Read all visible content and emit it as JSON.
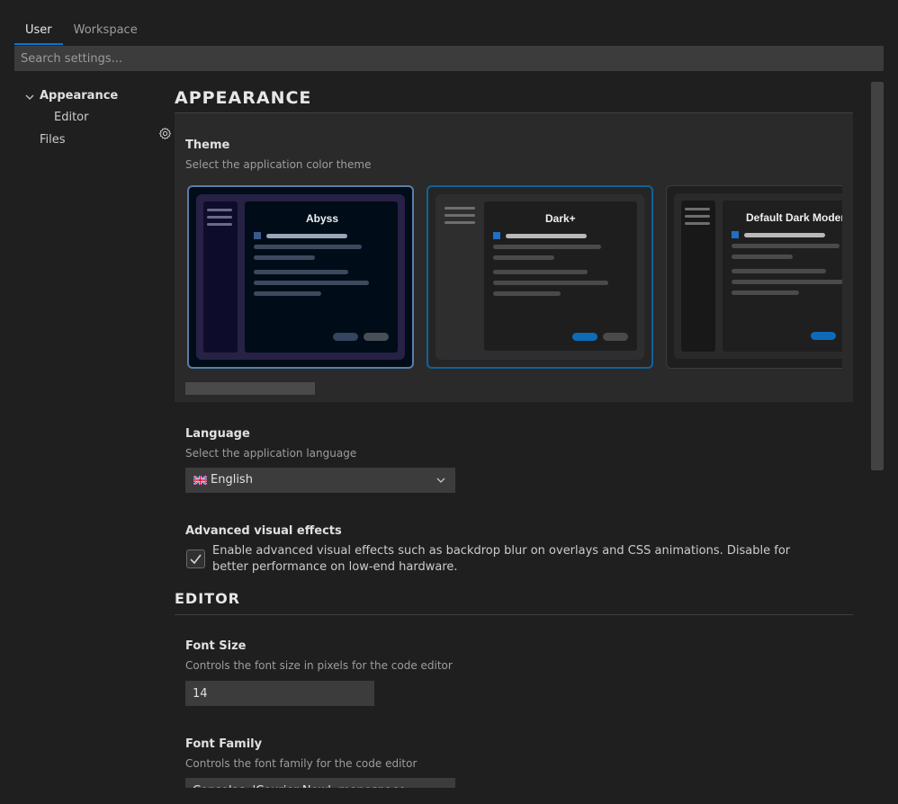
{
  "tabs": [
    {
      "label": "User",
      "active": true
    },
    {
      "label": "Workspace",
      "active": false
    }
  ],
  "search": {
    "placeholder": "Search settings..."
  },
  "tree": {
    "appearance": "Appearance",
    "editor": "Editor",
    "files": "Files"
  },
  "appearance": {
    "heading": "APPEARANCE",
    "theme": {
      "label": "Theme",
      "description": "Select the application color theme",
      "options": [
        {
          "name": "Abyss",
          "selected": false
        },
        {
          "name": "Dark+",
          "selected": true
        },
        {
          "name": "Default Dark Modern",
          "selected": false
        }
      ]
    },
    "language": {
      "label": "Language",
      "description": "Select the application language",
      "value": "English",
      "flag_icon": "uk-flag-icon"
    },
    "visual_effects": {
      "label": "Advanced visual effects",
      "checked": true,
      "description": "Enable advanced visual effects such as backdrop blur on overlays and CSS animations. Disable for better performance on low-end hardware."
    }
  },
  "editor": {
    "heading": "EDITOR",
    "font_size": {
      "label": "Font Size",
      "description": "Controls the font size in pixels for the code editor",
      "value": "14"
    },
    "font_family": {
      "label": "Font Family",
      "description": "Controls the font family for the code editor",
      "value": "Consolas, 'Courier New', monospace"
    }
  },
  "colors": {
    "accent": "#0078d4",
    "background": "#1f1f1f",
    "input": "#3c3c3c"
  }
}
